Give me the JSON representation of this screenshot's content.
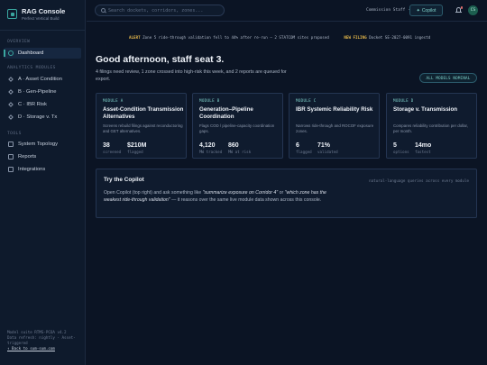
{
  "brand": {
    "title": "RAG Console",
    "subtitle": "Perfect Vertical Build"
  },
  "sidebar": {
    "sections": {
      "overview": "OVERVIEW",
      "analytics": "ANALYTICS MODULES",
      "tools": "TOOLS"
    },
    "items": [
      {
        "label": "Dashboard",
        "active": true
      },
      {
        "label": "A · Asset Condition"
      },
      {
        "label": "B · Gen-Pipeline"
      },
      {
        "label": "C · IBR Risk"
      },
      {
        "label": "D · Storage v. Tx"
      },
      {
        "label": "System Topology"
      },
      {
        "label": "Reports"
      },
      {
        "label": "Integrations"
      }
    ],
    "footer": {
      "line1": "Model suite RTMS-PCOA v4.2",
      "line2": "Data refresh: nightly · Asset-triggered",
      "link": "↑ Back to sum-sum.com"
    }
  },
  "topbar": {
    "search_placeholder": "Search dockets, corridors, zones...",
    "user": "Commission Staff · Seat 3",
    "copilot_label": "Copilot",
    "avatar_initials": "CS"
  },
  "ticker": {
    "alert_tag": "ALERT",
    "alert_text": "Zone 5 ride-through validation fell to 44% after re-run — 2 STATCOM sites proposed",
    "new_tag": "NEW FILING",
    "new_text": "Docket SE-2027-0091 ingestd"
  },
  "main": {
    "greeting": "Good afternoon, staff seat 3.",
    "intro": "4 filings need review, 1 zone crossed into high-risk this week, and 2 reports are queued for export.",
    "status_pill": "ALL MODELS NOMINAL"
  },
  "cards": [
    {
      "tag": "MODULE A",
      "title": "Asset-Condition Transmission Alternatives",
      "desc": "Screens rebuild filings against reconductoring and GET alternatives.",
      "stats": [
        {
          "value": "38",
          "label": "screened"
        },
        {
          "value": "$210M",
          "label": "flagged"
        }
      ]
    },
    {
      "tag": "MODULE B",
      "title": "Generation–Pipeline Coordination",
      "desc": "Flags COD / pipeline-capacity coordination gaps.",
      "stats": [
        {
          "value": "4,120",
          "label": "MW tracked"
        },
        {
          "value": "860",
          "label": "MW at risk"
        }
      ]
    },
    {
      "tag": "MODULE C",
      "title": "IBR Systemic Reliability Risk",
      "desc": "Narrows ride-through and ROCOF exposure zones.",
      "stats": [
        {
          "value": "6",
          "label": "flagged"
        },
        {
          "value": "71%",
          "label": "validated"
        }
      ]
    },
    {
      "tag": "MODULE D",
      "title": "Storage v. Transmission",
      "desc": "Compares reliability contribution per dollar, per month.",
      "stats": [
        {
          "value": "5",
          "label": "options"
        },
        {
          "value": "14mo",
          "label": "fastest"
        }
      ]
    }
  ],
  "try_copilot": {
    "title": "Try the Copilot",
    "hint": "natural-language queries across every module",
    "body_pre": "Open Copilot (top right) and ask something like ",
    "q1": "\"summarize exposure on Corridor 4\"",
    "body_mid": " or ",
    "q2": "\"which zone has the weakest ride-through validation\"",
    "body_post": " — it reasons over the same live module data shown across this console."
  }
}
